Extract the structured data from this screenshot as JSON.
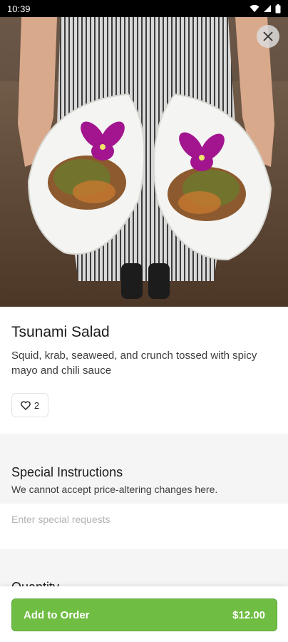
{
  "status_bar": {
    "time": "10:39",
    "icons": [
      "wifi-icon",
      "signal-icon",
      "battery-icon"
    ]
  },
  "hero": {
    "image": "photo of two white leaf-shaped bowls with salad and purple orchids, held by a person in a striped apron",
    "close_icon": "close-icon"
  },
  "item": {
    "title": "Tsunami Salad",
    "description": "Squid, krab, seaweed, and crunch tossed with spicy mayo and chili sauce",
    "like_icon": "heart-icon",
    "like_count": "2"
  },
  "special_instructions": {
    "title": "Special Instructions",
    "subtitle": "We cannot accept price-altering changes here.",
    "placeholder": "Enter special requests",
    "value": ""
  },
  "quantity": {
    "title": "Quantity"
  },
  "order": {
    "button_label": "Add to Order",
    "price": "$12.00",
    "accent_color": "#6fbd42"
  }
}
